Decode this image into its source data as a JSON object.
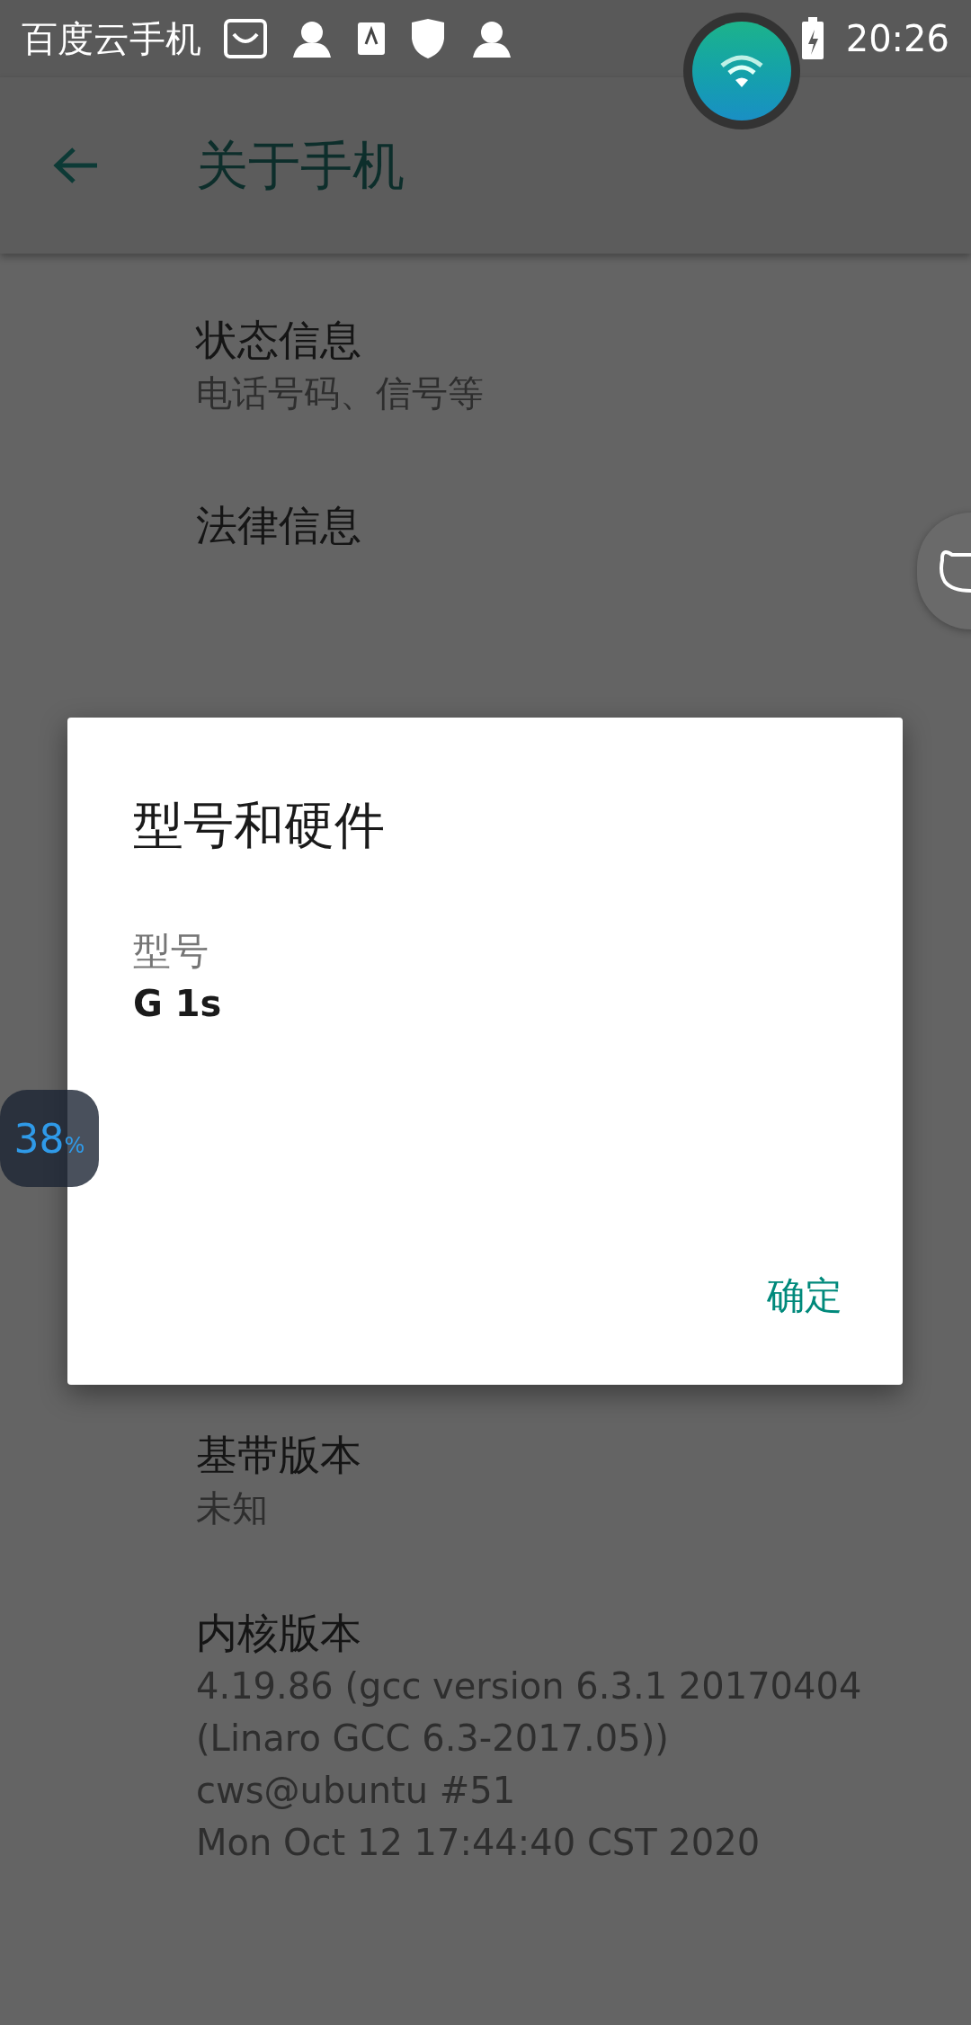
{
  "status_bar": {
    "app_name": "百度云手机",
    "time": "20:26"
  },
  "app_bar": {
    "title": "关于手机"
  },
  "items_top": [
    {
      "title": "状态信息",
      "summary": [
        "电话号码、信号等"
      ]
    },
    {
      "title": "法律信息"
    }
  ],
  "items_bottom": [
    {
      "title": "基带版本",
      "summary": [
        "未知"
      ]
    },
    {
      "title": "内核版本",
      "summary": [
        "4.19.86 (gcc version 6.3.1 20170404",
        "(Linaro GCC 6.3-2017.05))",
        "cws@ubuntu #51",
        "Mon Oct 12 17:44:40 CST 2020"
      ]
    }
  ],
  "dialog": {
    "title": "型号和硬件",
    "fields": [
      {
        "label": "型号",
        "value": "G 1s"
      }
    ],
    "button": "确定"
  },
  "memory_badge": {
    "value": "38",
    "unit": "%"
  }
}
